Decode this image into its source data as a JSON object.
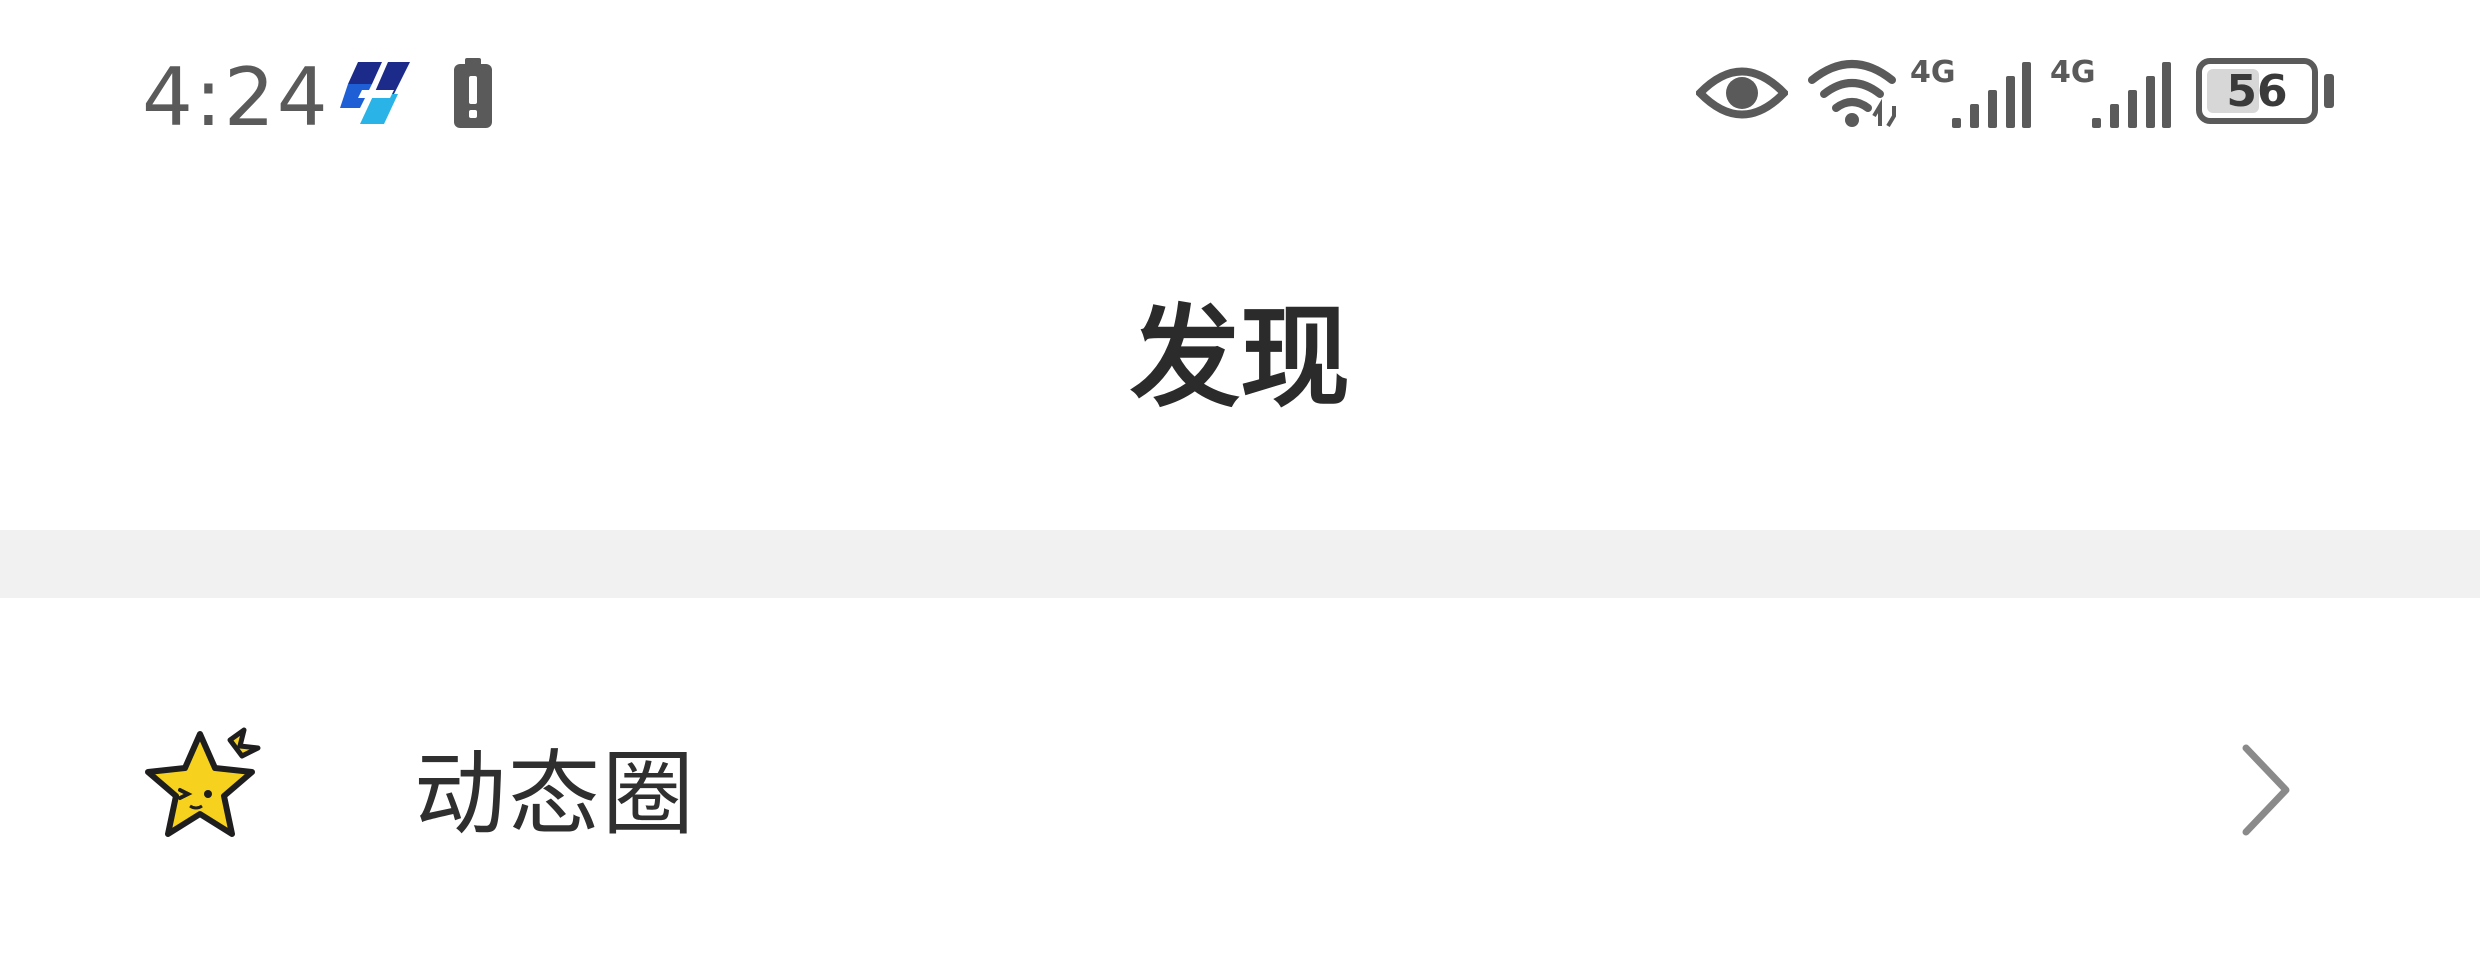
{
  "status_bar": {
    "time": "4:24",
    "network_type_1": "4G",
    "network_type_2": "4G",
    "battery_level": "56",
    "battery_fraction": 0.56,
    "icons": [
      "app-logo-icon",
      "battery-alert-icon",
      "eye-icon",
      "wifi-icon",
      "signal-icon",
      "signal-icon",
      "battery-icon"
    ]
  },
  "header": {
    "title": "发现"
  },
  "list": {
    "items": [
      {
        "label": "动态圈",
        "icon": "star-icon",
        "trailing_icon": "chevron-right-icon"
      }
    ]
  },
  "colors": {
    "background": "#ffffff",
    "divider": "#f1f1f1",
    "status_icons": "#5a5a5a",
    "title_text": "#2b2b2b",
    "star_fill": "#f6d21e",
    "logo_blue": "#1f5fd6",
    "logo_navy": "#1c2b8a",
    "logo_cyan": "#2ab3e6"
  }
}
